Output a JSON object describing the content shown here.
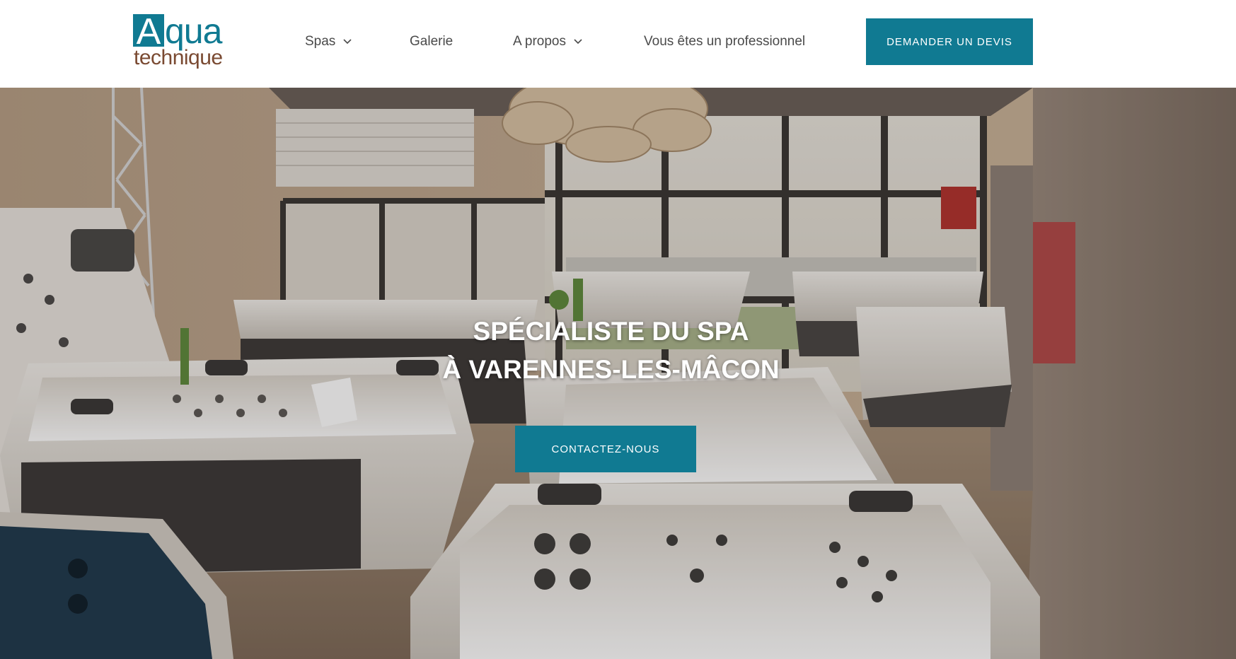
{
  "brand": {
    "logo_initial": "A",
    "logo_top": "qua",
    "logo_bottom": "technique",
    "primary_color": "#107a92",
    "secondary_color": "#7a4a32"
  },
  "nav": {
    "items": [
      {
        "label": "Spas",
        "has_dropdown": true,
        "icon": "chevron-down-icon"
      },
      {
        "label": "Galerie",
        "has_dropdown": false
      },
      {
        "label": "A propos",
        "has_dropdown": true,
        "icon": "chevron-down-icon"
      },
      {
        "label": "Vous êtes un professionnel",
        "has_dropdown": false
      }
    ],
    "cta_label": "DEMANDER UN DEVIS"
  },
  "hero": {
    "title_line1": "SPÉCIALISTE DU SPA",
    "title_line2": "À VARENNES-LES-MÂCON",
    "cta_label": "CONTACTEZ-NOUS"
  }
}
